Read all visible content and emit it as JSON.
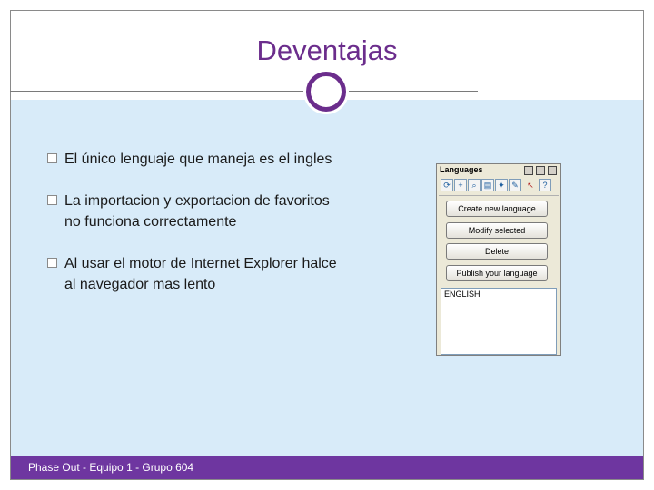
{
  "slide": {
    "title": "Deventajas",
    "bullets": [
      "El único lenguaje que maneja es el ingles",
      "La importacion y exportacion de favoritos no funciona correctamente",
      "Al usar el motor de Internet Explorer halce al navegador mas lento"
    ],
    "footer": "Phase Out - Equipo 1 - Grupo 604"
  },
  "language_panel": {
    "title": "Languages",
    "buttons": [
      "Create new language",
      "Modify selected",
      "Delete",
      "Publish your language"
    ],
    "list_items": [
      "ENGLISH"
    ]
  },
  "colors": {
    "accent": "#6b2d8c",
    "footer_bar": "#6e36a0",
    "panel_background": "#d8ebf9"
  }
}
